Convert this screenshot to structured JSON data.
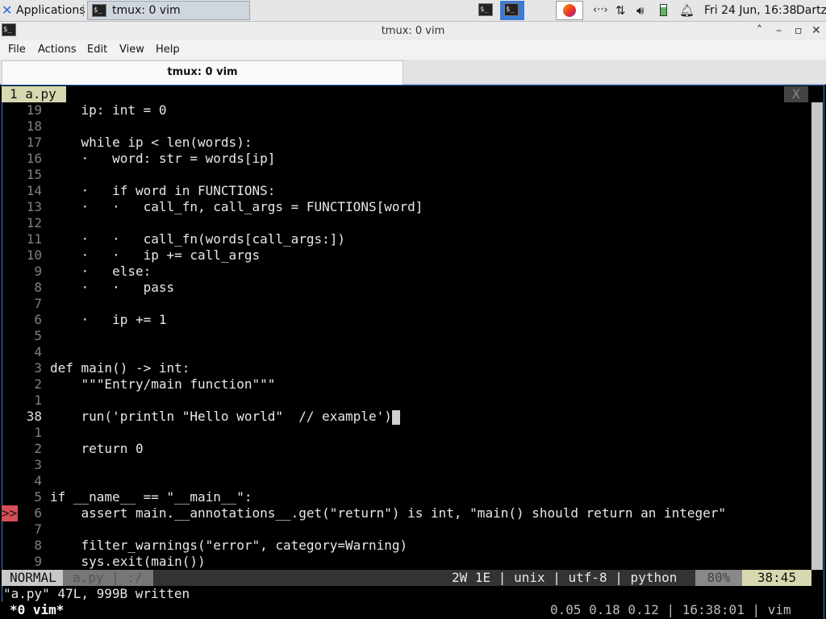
{
  "panel": {
    "applications_label": "Applications",
    "task_title": "tmux: 0 vim",
    "datetime": "Fri 24 Jun, 16:38",
    "user": "Dartz"
  },
  "window": {
    "title": "tmux: 0 vim",
    "minimize_glyph": "˄",
    "maximize_glyph": "–",
    "restore_glyph": "▫",
    "close_glyph": "✕"
  },
  "menubar": [
    "File",
    "Actions",
    "Edit",
    "View",
    "Help"
  ],
  "terminal_tab": {
    "title": "tmux: 0 vim"
  },
  "vim": {
    "tabline": {
      "tab": "1 a.py",
      "close": "X"
    },
    "lines": [
      {
        "num": "19",
        "text": "    ip: int = 0"
      },
      {
        "num": "18",
        "text": ""
      },
      {
        "num": "17",
        "text": "    while ip < len(words):"
      },
      {
        "num": "16",
        "text": "    ·   word: str = words[ip]"
      },
      {
        "num": "15",
        "text": ""
      },
      {
        "num": "14",
        "text": "    ·   if word in FUNCTIONS:"
      },
      {
        "num": "13",
        "text": "    ·   ·   call_fn, call_args = FUNCTIONS[word]"
      },
      {
        "num": "12",
        "text": ""
      },
      {
        "num": "11",
        "text": "    ·   ·   call_fn(words[call_args:])"
      },
      {
        "num": "10",
        "text": "    ·   ·   ip += call_args"
      },
      {
        "num": "9",
        "text": "    ·   else:"
      },
      {
        "num": "8",
        "text": "    ·   ·   pass"
      },
      {
        "num": "7",
        "text": ""
      },
      {
        "num": "6",
        "text": "    ·   ip += 1"
      },
      {
        "num": "5",
        "text": ""
      },
      {
        "num": "4",
        "text": ""
      },
      {
        "num": "3",
        "text": "def main() -> int:"
      },
      {
        "num": "2",
        "text": "    \"\"\"Entry/main function\"\"\""
      },
      {
        "num": "1",
        "text": ""
      },
      {
        "num": "38",
        "text": "    run('println \"Hello world\"  // example')",
        "current": true
      },
      {
        "num": "1",
        "text": ""
      },
      {
        "num": "2",
        "text": "    return 0"
      },
      {
        "num": "3",
        "text": ""
      },
      {
        "num": "4",
        "text": ""
      },
      {
        "num": "5",
        "text": "if __name__ == \"__main__\":"
      },
      {
        "num": "6",
        "text": "    assert main.__annotations__.get(\"return\") is int, \"main() should return an integer\""
      },
      {
        "num": "7",
        "text": ""
      },
      {
        "num": "8",
        "text": "    filter_warnings(\"error\", category=Warning)"
      },
      {
        "num": "9",
        "text": "    sys.exit(main())"
      }
    ],
    "sign": ">>",
    "statusline": {
      "mode": "NORMAL",
      "file": "a.py | :/",
      "info": "2W 1E | unix | utf-8 | python",
      "percent": "80%",
      "position": "38:45"
    },
    "message": "\"a.py\" 47L, 999B written"
  },
  "tmux": {
    "window": "*0 vim*",
    "status_right": "0.05 0.18 0.12 | 16:38:01 | vim"
  }
}
